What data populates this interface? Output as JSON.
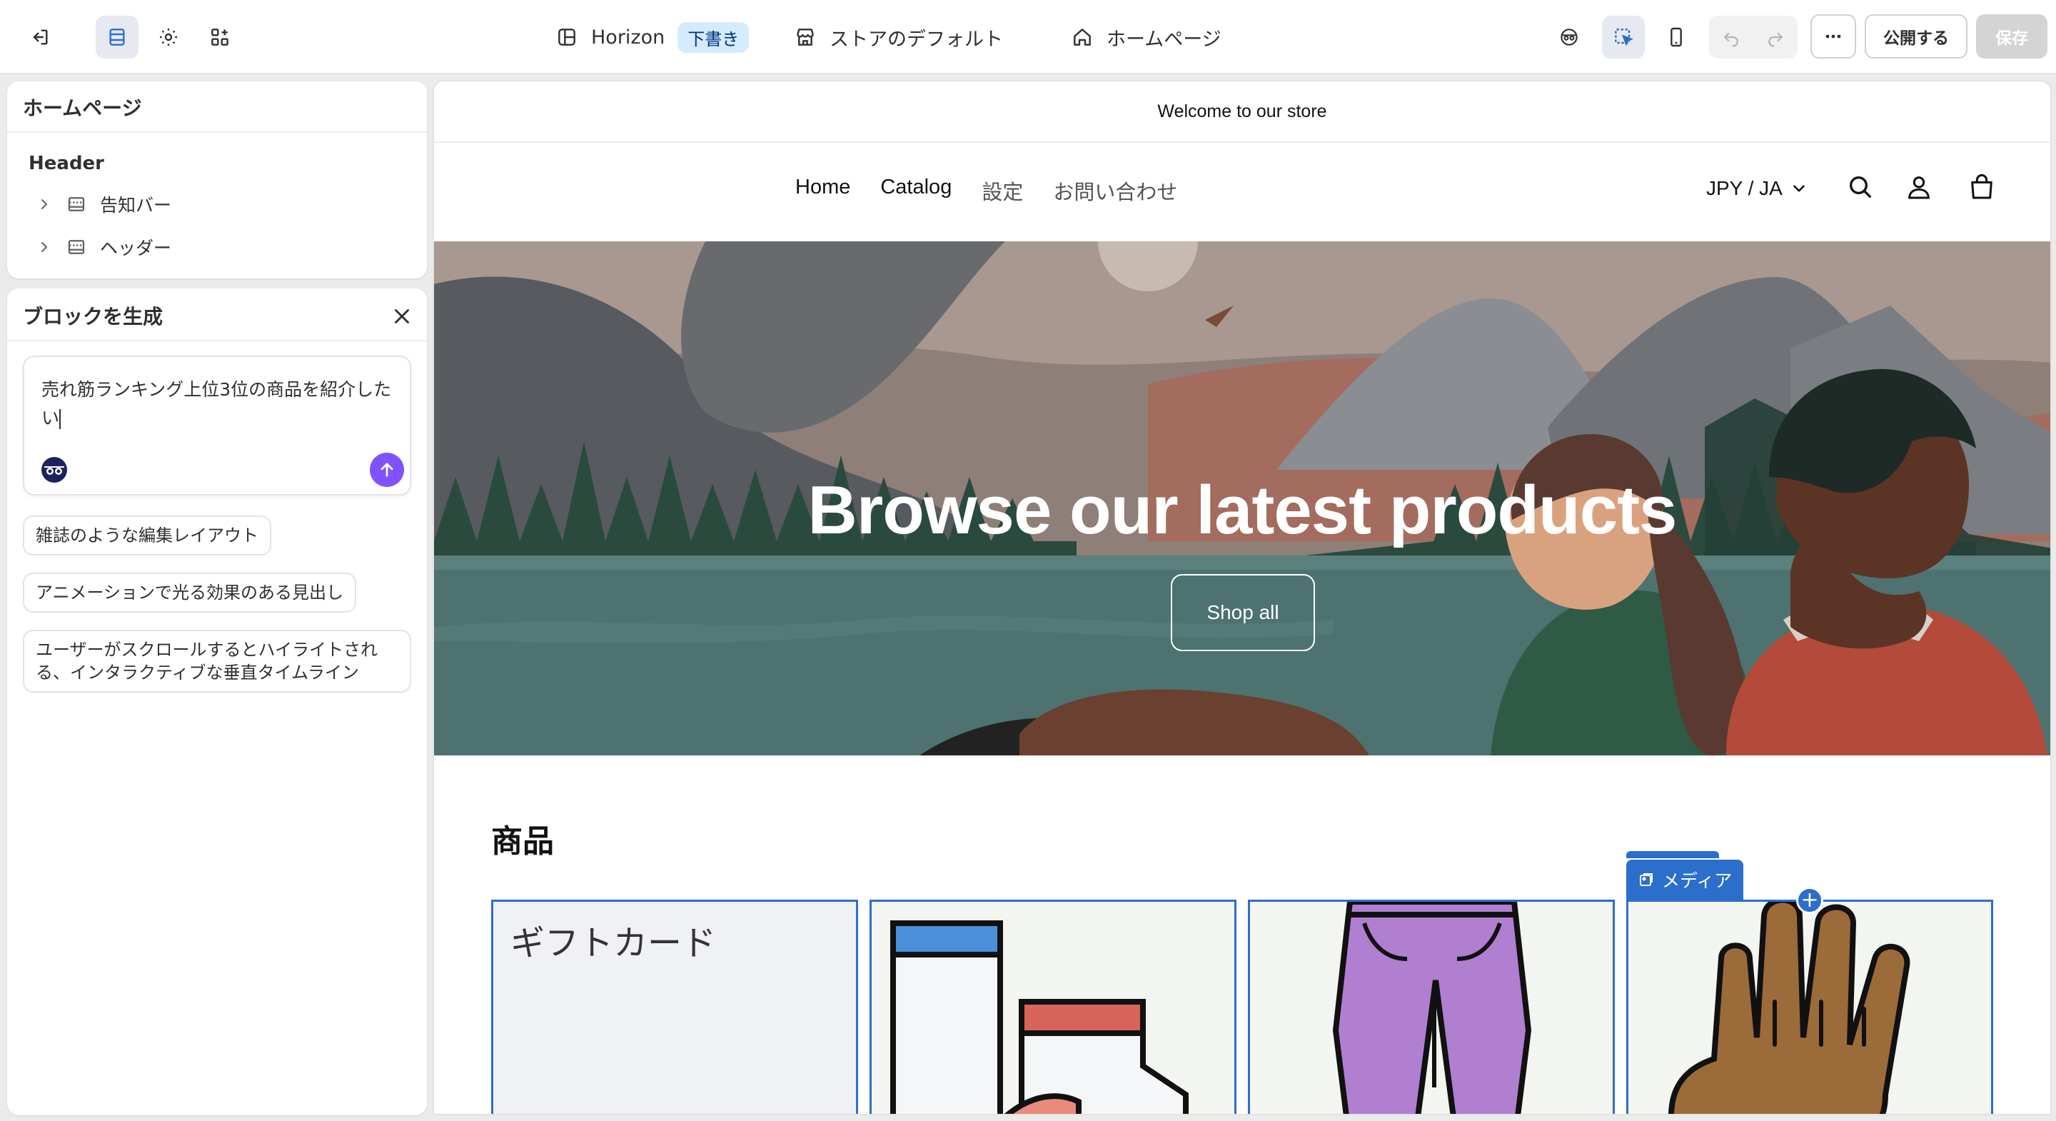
{
  "topbar": {
    "theme_name": "Horizon",
    "draft_badge": "下書き",
    "store_default": "ストアのデフォルト",
    "page_selector": "ホームページ",
    "publish_label": "公開する",
    "save_label": "保存"
  },
  "sections_panel": {
    "title": "ホームページ",
    "group_label": "Header",
    "items": [
      {
        "label": "告知バー"
      },
      {
        "label": "ヘッダー"
      }
    ]
  },
  "generate_panel": {
    "title": "ブロックを生成",
    "prompt_value": "売れ筋ランキング上位3位の商品を紹介したい",
    "suggestions": [
      "雑誌のような編集レイアウト",
      "アニメーションで光る効果のある見出し",
      "ユーザーがスクロールするとハイライトされる、インタラクティブな垂直タイムライン"
    ]
  },
  "preview": {
    "announcement": "Welcome to our store",
    "nav": [
      "Home",
      "Catalog",
      "設定",
      "お問い合わせ"
    ],
    "locale": "JPY / JA",
    "hero_title": "Browse our latest products",
    "hero_button": "Shop all",
    "section_title": "商品",
    "gift_card_label": "ギフトカード",
    "media_tag": "メディア"
  },
  "colors": {
    "accent_blue": "#2c6ecb",
    "generate_purple": "#8051ff",
    "draft_badge_bg": "#d5ebff"
  }
}
